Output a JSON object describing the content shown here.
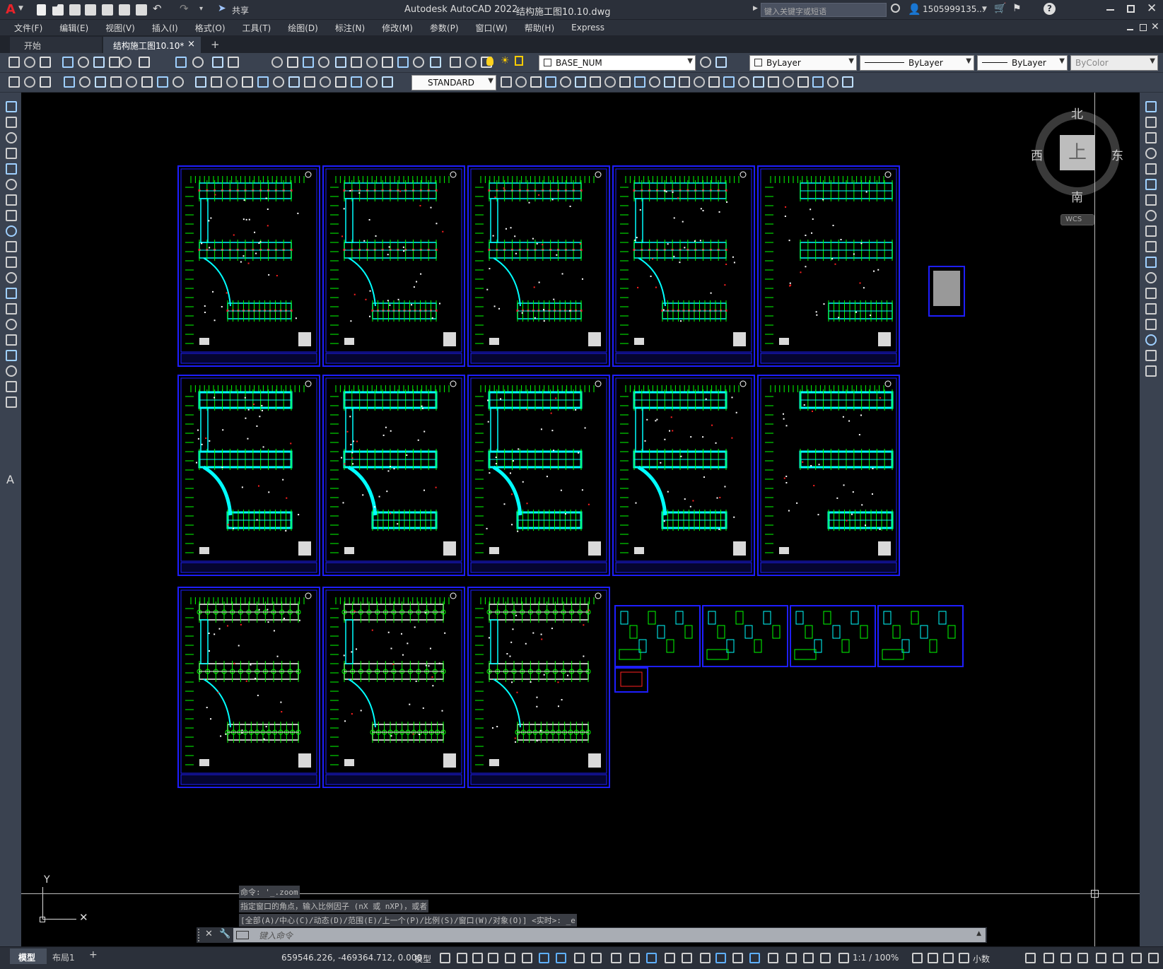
{
  "app": {
    "title": "Autodesk AutoCAD 2022",
    "document": "结构施工图10.10.dwg",
    "share_label": "共享",
    "search_placeholder": "键入关键字或短语",
    "user": "1505999135...",
    "logo": "A"
  },
  "menu": [
    "文件(F)",
    "编辑(E)",
    "视图(V)",
    "插入(I)",
    "格式(O)",
    "工具(T)",
    "绘图(D)",
    "标注(N)",
    "修改(M)",
    "参数(P)",
    "窗口(W)",
    "帮助(H)",
    "Express"
  ],
  "tabs": {
    "start": "开始",
    "active": "结构施工图10.10*",
    "close": "×",
    "add": "+"
  },
  "toolbar": {
    "layer_name": "BASE_NUM",
    "color": "ByLayer",
    "linetype": "ByLayer",
    "lineweight": "ByLayer",
    "plotstyle": "ByColor",
    "text_style": "STANDARD"
  },
  "viewcube": {
    "north": "北",
    "south": "南",
    "east": "东",
    "west": "西",
    "top": "上",
    "wcs": "WCS"
  },
  "ucs": {
    "x": "X",
    "y": "Y"
  },
  "command": {
    "history": [
      "命令: '_.zoom",
      "指定窗口的角点，输入比例因子 (nX 或 nXP)，或者",
      "[全部(A)/中心(C)/动态(D)/范围(E)/上一个(P)/比例(S)/窗口(W)/对象(O)] <实时>: _e"
    ],
    "placeholder": "键入命令"
  },
  "layouts": {
    "model": "模型",
    "layout1": "布局1",
    "add": "+"
  },
  "status": {
    "coords": "659546.226, -469364.712, 0.000",
    "space": "模型",
    "scale": "1:1 / 100%",
    "units": "小数"
  },
  "colors": {
    "sheet_border": "#1e1eff",
    "grid_green": "#00ff00",
    "beam_cyan": "#00ffff",
    "column_red": "#ff2020",
    "canvas": "#000000"
  },
  "icons": [
    "new-icon",
    "open-icon",
    "save-icon",
    "saveas-icon",
    "plot-icon",
    "undo-icon",
    "redo-icon",
    "share-icon",
    "search-icon",
    "user-icon",
    "cart-icon",
    "help-icon",
    "minimize-icon",
    "maximize-icon",
    "close-icon"
  ]
}
